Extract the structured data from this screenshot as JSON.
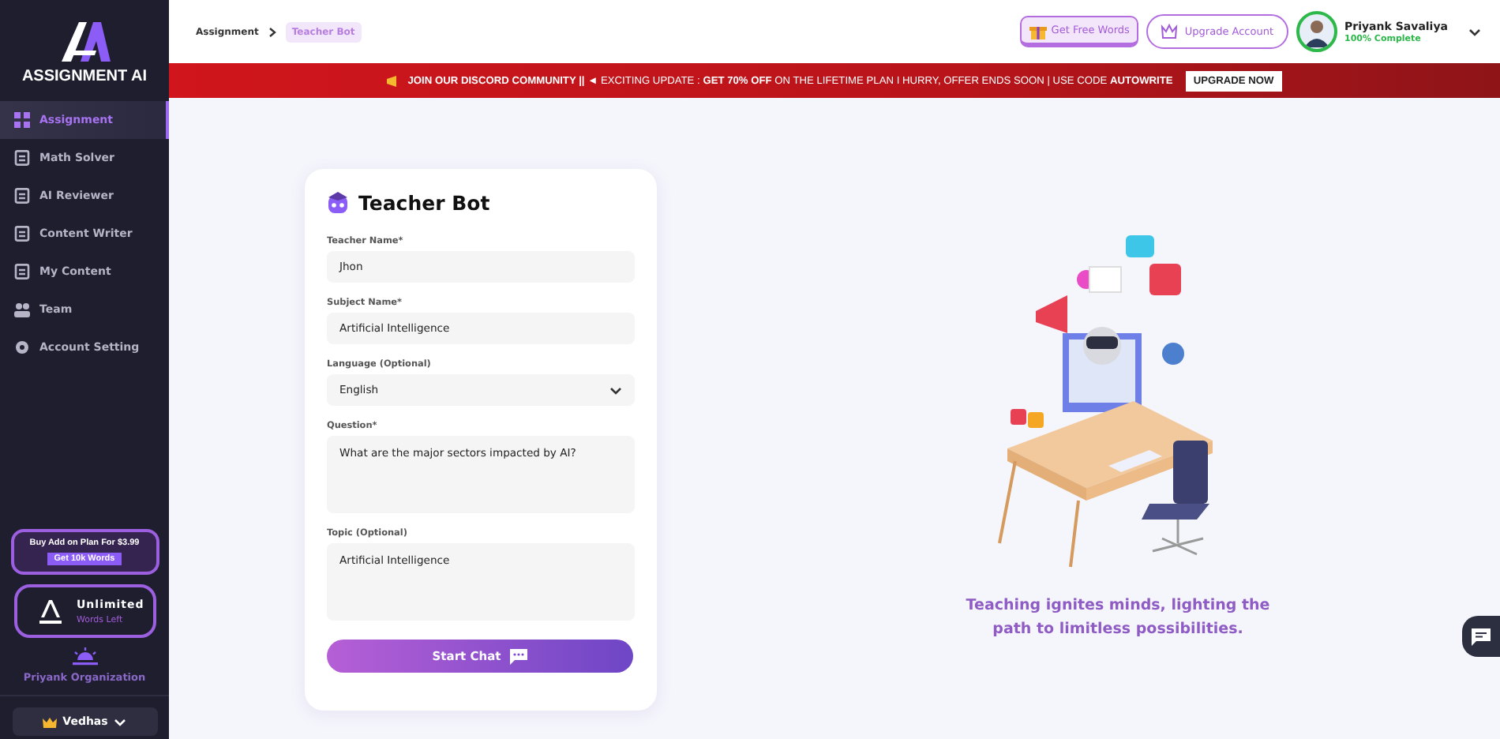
{
  "sidebar": {
    "brand": "ASSIGNMENT AI",
    "items": [
      {
        "label": "Assignment",
        "selected": true
      },
      {
        "label": "Math Solver",
        "selected": false
      },
      {
        "label": "AI Reviewer",
        "selected": false
      },
      {
        "label": "Content Writer",
        "selected": false
      },
      {
        "label": "My Content",
        "selected": false
      },
      {
        "label": "Team",
        "selected": false
      },
      {
        "label": "Account Setting",
        "selected": false
      }
    ],
    "promo": {
      "text": "Buy Add on Plan For $3.99",
      "button": "Get 10k Words"
    },
    "plan": {
      "title": "Unlimited",
      "subtitle": "Words Left"
    },
    "organization": "Priyank Organization",
    "workspace": "Vedhas"
  },
  "breadcrumb": [
    "Assignment",
    "Teacher Bot"
  ],
  "header": {
    "free_words": "Get Free Words",
    "upgrade": "Upgrade Account",
    "user": {
      "name": "Priyank Savaliya",
      "status": "100% Complete"
    }
  },
  "banner": {
    "text": "**JOIN OUR DISCORD COMMUNITY ||** ◄ EXCITING UPDATE : **GET 70% OFF** ON THE LIFETIME PLAN I HURRY, OFFER ENDS SOON | USE CODE **AUTOWRITE**",
    "button": "UPGRADE NOW"
  },
  "form": {
    "title": "Teacher Bot",
    "fields": [
      {
        "label": "Teacher Name*",
        "kind": "input",
        "value": "Jhon"
      },
      {
        "label": "Subject Name*",
        "kind": "input",
        "value": "Artificial Intelligence"
      },
      {
        "label": "Language (Optional)",
        "kind": "select",
        "value": "English"
      },
      {
        "label": "Question*",
        "kind": "textarea",
        "value": "What are the major sectors impacted by AI?"
      },
      {
        "label": "Topic (Optional)",
        "kind": "textarea",
        "value": "Artificial Intelligence"
      }
    ],
    "submit": "Start Chat"
  },
  "caption": "Teaching ignites minds, lighting the path to limitless possibilities."
}
